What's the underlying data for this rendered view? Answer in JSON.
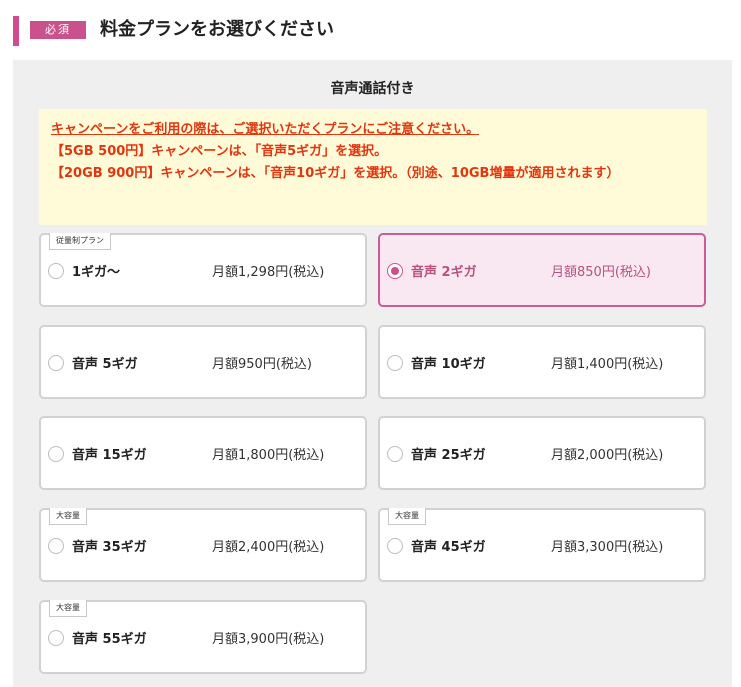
{
  "header": {
    "required_label": "必須",
    "title": "料金プランをお選びください"
  },
  "section": {
    "title": "音声通話付き"
  },
  "notice": {
    "line1": "キャンペーンをご利用の際は、ご選択いただくプランにご注意ください。",
    "line2": "【5GB 500円】キャンペーンは、「音声5ギガ」を選択。",
    "line3": "【20GB 900円】キャンペーンは、「音声10ギガ」を選択。（別途、10GB増量が適用されます）"
  },
  "plans": [
    {
      "name": "1ギガ～",
      "price": "月額1,298円(税込)",
      "tag": "従量制プラン",
      "selected": false
    },
    {
      "name": "音声 2ギガ",
      "price": "月額850円(税込)",
      "tag": "",
      "selected": true
    },
    {
      "name": "音声 5ギガ",
      "price": "月額950円(税込)",
      "tag": "",
      "selected": false
    },
    {
      "name": "音声 10ギガ",
      "price": "月額1,400円(税込)",
      "tag": "",
      "selected": false
    },
    {
      "name": "音声 15ギガ",
      "price": "月額1,800円(税込)",
      "tag": "",
      "selected": false
    },
    {
      "name": "音声 25ギガ",
      "price": "月額2,000円(税込)",
      "tag": "",
      "selected": false
    },
    {
      "name": "音声 35ギガ",
      "price": "月額2,400円(税込)",
      "tag": "大容量",
      "selected": false
    },
    {
      "name": "音声 45ギガ",
      "price": "月額3,300円(税込)",
      "tag": "大容量",
      "selected": false
    },
    {
      "name": "音声 55ギガ",
      "price": "月額3,900円(税込)",
      "tag": "大容量",
      "selected": false
    }
  ],
  "colors": {
    "accent": "#d24a8f",
    "notice_text": "#e1360f",
    "notice_bg": "#fffbd8",
    "selected_bg": "#f9e8f2",
    "selected_border": "#cc5c97"
  }
}
